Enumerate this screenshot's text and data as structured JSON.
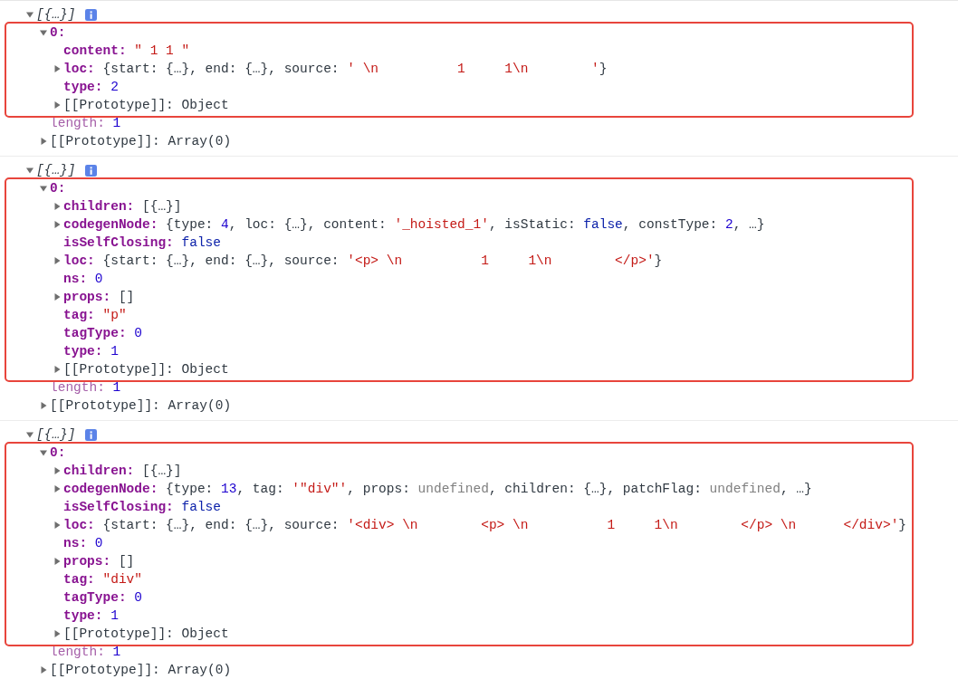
{
  "console": {
    "entries": [
      {
        "summary": "[{…}]",
        "expanded": true,
        "children": [
          {
            "key": "0:",
            "kind": "own",
            "expanded": true,
            "highlighted": true,
            "children": [
              {
                "key": "content:",
                "kind": "own",
                "value": [
                  {
                    "text": "\" 1 1 \"",
                    "kind": "string"
                  }
                ]
              },
              {
                "key": "loc:",
                "kind": "own",
                "expanded": false,
                "value": [
                  {
                    "text": "{start: {…}, end: {…}, source: ",
                    "kind": "plain"
                  },
                  {
                    "text": "' \\n          1     1\\n        '",
                    "kind": "string"
                  },
                  {
                    "text": "}",
                    "kind": "plain"
                  }
                ]
              },
              {
                "key": "type:",
                "kind": "own",
                "value": [
                  {
                    "text": "2",
                    "kind": "number"
                  }
                ]
              },
              {
                "key": "[[Prototype]]:",
                "kind": "internal",
                "expanded": false,
                "value": [
                  {
                    "text": "Object",
                    "kind": "plain"
                  }
                ]
              }
            ]
          },
          {
            "key": "length:",
            "kind": "meta",
            "value": [
              {
                "text": "1",
                "kind": "number"
              }
            ]
          },
          {
            "key": "[[Prototype]]:",
            "kind": "internal",
            "expanded": false,
            "value": [
              {
                "text": "Array(0)",
                "kind": "plain"
              }
            ]
          }
        ]
      },
      {
        "summary": "[{…}]",
        "expanded": true,
        "children": [
          {
            "key": "0:",
            "kind": "own",
            "expanded": true,
            "highlighted": true,
            "children": [
              {
                "key": "children:",
                "kind": "own",
                "expanded": false,
                "value": [
                  {
                    "text": "[{…}]",
                    "kind": "plain"
                  }
                ]
              },
              {
                "key": "codegenNode:",
                "kind": "own",
                "expanded": false,
                "value": [
                  {
                    "text": "{type: ",
                    "kind": "plain"
                  },
                  {
                    "text": "4",
                    "kind": "number"
                  },
                  {
                    "text": ", loc: {…}, content: ",
                    "kind": "plain"
                  },
                  {
                    "text": "'_hoisted_1'",
                    "kind": "string"
                  },
                  {
                    "text": ", isStatic: ",
                    "kind": "plain"
                  },
                  {
                    "text": "false",
                    "kind": "keyword"
                  },
                  {
                    "text": ", constType: ",
                    "kind": "plain"
                  },
                  {
                    "text": "2",
                    "kind": "number"
                  },
                  {
                    "text": ", …}",
                    "kind": "plain"
                  }
                ]
              },
              {
                "key": "isSelfClosing:",
                "kind": "own",
                "value": [
                  {
                    "text": "false",
                    "kind": "keyword"
                  }
                ]
              },
              {
                "key": "loc:",
                "kind": "own",
                "expanded": false,
                "value": [
                  {
                    "text": "{start: {…}, end: {…}, source: ",
                    "kind": "plain"
                  },
                  {
                    "text": "'<p> \\n          1     1\\n        </p>'",
                    "kind": "string"
                  },
                  {
                    "text": "}",
                    "kind": "plain"
                  }
                ]
              },
              {
                "key": "ns:",
                "kind": "own",
                "value": [
                  {
                    "text": "0",
                    "kind": "number"
                  }
                ]
              },
              {
                "key": "props:",
                "kind": "own",
                "expanded": false,
                "value": [
                  {
                    "text": "[]",
                    "kind": "plain"
                  }
                ]
              },
              {
                "key": "tag:",
                "kind": "own",
                "value": [
                  {
                    "text": "\"p\"",
                    "kind": "string"
                  }
                ]
              },
              {
                "key": "tagType:",
                "kind": "own",
                "value": [
                  {
                    "text": "0",
                    "kind": "number"
                  }
                ]
              },
              {
                "key": "type:",
                "kind": "own",
                "value": [
                  {
                    "text": "1",
                    "kind": "number"
                  }
                ]
              },
              {
                "key": "[[Prototype]]:",
                "kind": "internal",
                "expanded": false,
                "value": [
                  {
                    "text": "Object",
                    "kind": "plain"
                  }
                ]
              }
            ]
          },
          {
            "key": "length:",
            "kind": "meta",
            "value": [
              {
                "text": "1",
                "kind": "number"
              }
            ]
          },
          {
            "key": "[[Prototype]]:",
            "kind": "internal",
            "expanded": false,
            "value": [
              {
                "text": "Array(0)",
                "kind": "plain"
              }
            ]
          }
        ]
      },
      {
        "summary": "[{…}]",
        "expanded": true,
        "children": [
          {
            "key": "0:",
            "kind": "own",
            "expanded": true,
            "highlighted": true,
            "children": [
              {
                "key": "children:",
                "kind": "own",
                "expanded": false,
                "value": [
                  {
                    "text": "[{…}]",
                    "kind": "plain"
                  }
                ]
              },
              {
                "key": "codegenNode:",
                "kind": "own",
                "expanded": false,
                "value": [
                  {
                    "text": "{type: ",
                    "kind": "plain"
                  },
                  {
                    "text": "13",
                    "kind": "number"
                  },
                  {
                    "text": ", tag: ",
                    "kind": "plain"
                  },
                  {
                    "text": "'\"div\"'",
                    "kind": "string"
                  },
                  {
                    "text": ", props: ",
                    "kind": "plain"
                  },
                  {
                    "text": "undefined",
                    "kind": "muted"
                  },
                  {
                    "text": ", children: {…}, patchFlag: ",
                    "kind": "plain"
                  },
                  {
                    "text": "undefined",
                    "kind": "muted"
                  },
                  {
                    "text": ", …}",
                    "kind": "plain"
                  }
                ]
              },
              {
                "key": "isSelfClosing:",
                "kind": "own",
                "value": [
                  {
                    "text": "false",
                    "kind": "keyword"
                  }
                ]
              },
              {
                "key": "loc:",
                "kind": "own",
                "expanded": false,
                "value": [
                  {
                    "text": "{start: {…}, end: {…}, source: ",
                    "kind": "plain"
                  },
                  {
                    "text": "'<div> \\n        <p> \\n          1     1\\n        </p> \\n      </div>'",
                    "kind": "string"
                  },
                  {
                    "text": "}",
                    "kind": "plain"
                  }
                ]
              },
              {
                "key": "ns:",
                "kind": "own",
                "value": [
                  {
                    "text": "0",
                    "kind": "number"
                  }
                ]
              },
              {
                "key": "props:",
                "kind": "own",
                "expanded": false,
                "value": [
                  {
                    "text": "[]",
                    "kind": "plain"
                  }
                ]
              },
              {
                "key": "tag:",
                "kind": "own",
                "value": [
                  {
                    "text": "\"div\"",
                    "kind": "string"
                  }
                ]
              },
              {
                "key": "tagType:",
                "kind": "own",
                "value": [
                  {
                    "text": "0",
                    "kind": "number"
                  }
                ]
              },
              {
                "key": "type:",
                "kind": "own",
                "value": [
                  {
                    "text": "1",
                    "kind": "number"
                  }
                ]
              },
              {
                "key": "[[Prototype]]:",
                "kind": "internal",
                "expanded": false,
                "value": [
                  {
                    "text": "Object",
                    "kind": "plain"
                  }
                ]
              }
            ]
          },
          {
            "key": "length:",
            "kind": "meta",
            "value": [
              {
                "text": "1",
                "kind": "number"
              }
            ]
          },
          {
            "key": "[[Prototype]]:",
            "kind": "internal",
            "expanded": false,
            "value": [
              {
                "text": "Array(0)",
                "kind": "plain"
              }
            ]
          }
        ]
      }
    ]
  }
}
